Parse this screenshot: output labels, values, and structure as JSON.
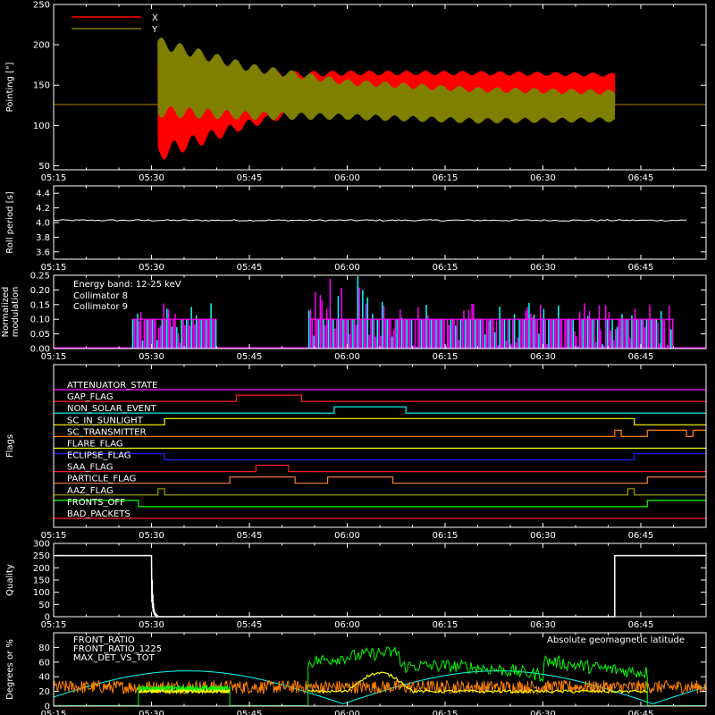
{
  "chart_data": [
    {
      "type": "line",
      "ylabel": "Pointing [\"]",
      "ylim": [
        45,
        250
      ],
      "yticks": [
        50,
        100,
        150,
        200,
        250
      ],
      "legend": {
        "placement": "top-left",
        "entries": [
          {
            "name": "X",
            "color": "#ff0000"
          },
          {
            "name": "Y",
            "color": "#808000"
          }
        ]
      },
      "series": [
        {
          "name": "X",
          "color": "#ff0000",
          "baseline": 126,
          "oscillation": {
            "start": "05:31",
            "end": "06:41",
            "center": [
              [
                "05:31",
                125
              ],
              [
                "05:45",
                132
              ],
              [
                "06:00",
                148
              ],
              [
                "06:20",
                150
              ],
              [
                "06:41",
                150
              ]
            ],
            "half_amplitude": [
              [
                "05:31",
                70
              ],
              [
                "05:45",
                35
              ],
              [
                "06:00",
                20
              ],
              [
                "06:41",
                15
              ]
            ]
          }
        },
        {
          "name": "Y",
          "color": "#808000",
          "baseline": 126,
          "oscillation": {
            "start": "05:31",
            "end": "06:41",
            "center": [
              [
                "05:31",
                160
              ],
              [
                "05:45",
                142
              ],
              [
                "06:00",
                132
              ],
              [
                "06:20",
                125
              ],
              [
                "06:41",
                124
              ]
            ],
            "half_amplitude": [
              [
                "05:31",
                50
              ],
              [
                "05:45",
                35
              ],
              [
                "06:00",
                25
              ],
              [
                "06:41",
                20
              ]
            ]
          }
        }
      ]
    },
    {
      "type": "line",
      "ylabel": "Roll period [s]",
      "ylim": [
        3.5,
        4.5
      ],
      "yticks": [
        3.6,
        3.8,
        4.0,
        4.2,
        4.4
      ],
      "series": [
        {
          "name": "",
          "color": "#ffffff",
          "value": 4.03
        }
      ]
    },
    {
      "type": "bar",
      "ylabel": [
        "Normalized",
        "modulation"
      ],
      "ylim": [
        0,
        0.25
      ],
      "yticks": [
        0.0,
        0.05,
        0.1,
        0.15,
        0.2,
        0.25
      ],
      "annotation": "Energy band: 12-25 keV",
      "legend": {
        "placement": "top-left",
        "entries": [
          {
            "name": "Collimator 8",
            "color": "#00ffff"
          },
          {
            "name": "Collimator 9",
            "color": "#ff00ff"
          }
        ]
      },
      "segments": [
        {
          "start": "05:27",
          "end": "05:40",
          "level": 0.1
        },
        {
          "start": "05:54",
          "end": "06:50",
          "level": 0.1
        }
      ]
    },
    {
      "type": "line",
      "ylabel": "Flags",
      "flags": [
        {
          "name": "ATTENUATOR_STATE",
          "color": "#ff00ff",
          "transitions": []
        },
        {
          "name": "GAP_FLAG",
          "color": "#ff2020",
          "transitions": [
            [
              "05:43",
              1
            ],
            [
              "05:53",
              0
            ]
          ]
        },
        {
          "name": "NON_SOLAR_EVENT",
          "color": "#00ffff",
          "transitions": [
            [
              "05:58",
              1
            ],
            [
              "06:09",
              0
            ]
          ]
        },
        {
          "name": "SC_IN_SUNLIGHT",
          "color": "#ffff00",
          "transitions": [
            [
              "05:32",
              1
            ],
            [
              "06:44",
              0
            ]
          ]
        },
        {
          "name": "SC_TRANSMITTER",
          "color": "#ff8000",
          "transitions": [
            [
              "06:41",
              1
            ],
            [
              "06:42",
              0
            ],
            [
              "06:46",
              1
            ],
            [
              "06:52",
              0
            ],
            [
              "06:53",
              1
            ]
          ]
        },
        {
          "name": "FLARE_FLAG",
          "color": "#ffff00",
          "transitions": []
        },
        {
          "name": "ECLIPSE_FLAG",
          "color": "#2020ff",
          "transitions": [
            [
              "05:32",
              0
            ],
            [
              "06:44",
              1
            ]
          ]
        },
        {
          "name": "SAA_FLAG",
          "color": "#ff2020",
          "transitions": [
            [
              "05:46",
              1
            ],
            [
              "05:51",
              0
            ]
          ]
        },
        {
          "name": "PARTICLE_FLAG",
          "color": "#ff8040",
          "transitions": [
            [
              "05:42",
              1
            ],
            [
              "05:52",
              0
            ],
            [
              "05:57",
              1
            ],
            [
              "06:07",
              0
            ],
            [
              "06:46",
              1
            ]
          ]
        },
        {
          "name": "AAZ_FLAG",
          "color": "#a0a000",
          "transitions": [
            [
              "05:31",
              1
            ],
            [
              "05:32",
              0
            ],
            [
              "06:43",
              1
            ],
            [
              "06:44",
              0
            ]
          ]
        },
        {
          "name": "FRONTS_OFF",
          "color": "#00ff00",
          "transitions": [
            [
              "05:28",
              0
            ],
            [
              "06:46",
              1
            ]
          ]
        },
        {
          "name": "BAD_PACKETS",
          "color": "#ff2020",
          "transitions": []
        }
      ]
    },
    {
      "type": "line",
      "ylabel": "Quality",
      "ylim": [
        0,
        300
      ],
      "yticks": [
        0,
        50,
        100,
        150,
        200,
        250,
        300
      ],
      "series": [
        {
          "name": "",
          "color": "#ffffff",
          "points": [
            [
              "05:15",
              250
            ],
            [
              "05:30",
              250
            ],
            [
              "05:31",
              0
            ],
            [
              "06:41",
              0
            ],
            [
              "06:41",
              250
            ],
            [
              "06:55",
              250
            ]
          ]
        }
      ]
    },
    {
      "type": "line",
      "ylabel": "Degrees or %",
      "ylim": [
        0,
        100
      ],
      "yticks": [
        0,
        20,
        40,
        60,
        80
      ],
      "legend": {
        "placement": "top-left",
        "entries": [
          {
            "name": "FRONT_RATIO",
            "color": "#ffff00"
          },
          {
            "name": "FRONT_RATIO_1225",
            "color": "#00ff00"
          },
          {
            "name": "MAX_DET_VS_TOT",
            "color": "#ff8000"
          }
        ]
      },
      "annotation": "Absolute geomagnetic latitude",
      "annotation_color": "#00ffff",
      "series": [
        {
          "name": "FRONT_RATIO",
          "color": "#ffff00",
          "level": 22,
          "segments": [
            [
              "05:28",
              "05:42"
            ],
            [
              "05:54",
              "06:46"
            ]
          ]
        },
        {
          "name": "FRONT_RATIO_1225",
          "color": "#00ff00",
          "level": 28,
          "segments": [
            [
              "05:28",
              "05:42"
            ],
            [
              "05:54",
              "06:46"
            ]
          ]
        },
        {
          "name": "MAX_DET_VS_TOT",
          "color": "#ff8000",
          "level": 28
        },
        {
          "name": "Absolute geomagnetic latitude",
          "color": "#00ffff",
          "level": 30
        }
      ]
    }
  ],
  "time_axis": {
    "ticks": [
      "05:15",
      "05:30",
      "05:45",
      "06:00",
      "06:15",
      "06:30",
      "06:45"
    ],
    "start": "05:15",
    "end": "06:55"
  },
  "colors": {
    "background": "#000000",
    "axis": "#ffffff"
  }
}
